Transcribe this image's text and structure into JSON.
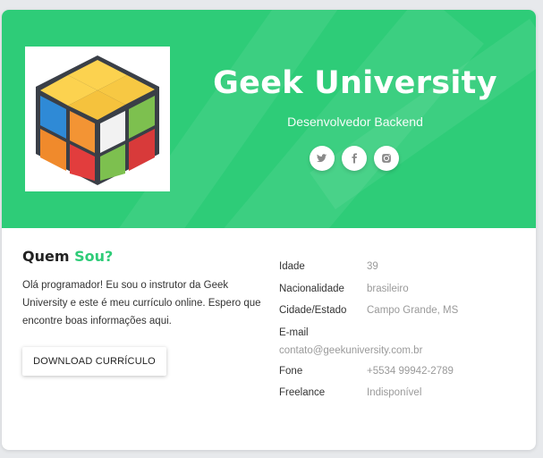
{
  "header": {
    "title": "Geek University",
    "subtitle": "Desenvolvedor Backend",
    "accent_color": "#2ecc78",
    "avatar_icon": "rubiks-cube-logo",
    "socials": [
      {
        "name": "twitter-icon"
      },
      {
        "name": "facebook-icon"
      },
      {
        "name": "instagram-icon"
      }
    ]
  },
  "about": {
    "title_prefix": "Quem",
    "title_accent": "Sou?",
    "text": "Olá programador! Eu sou o instrutor da Geek University e este é meu currículo online. Espero que encontre boas informações aqui.",
    "download_label": "DOWNLOAD CURRÍCULO"
  },
  "info": [
    {
      "label": "Idade",
      "value": "39"
    },
    {
      "label": "Nacionalidade",
      "value": "brasileiro"
    },
    {
      "label": "Cidade/Estado",
      "value": "Campo Grande, MS"
    },
    {
      "label": "E-mail",
      "value": "contato@geekuniversity.com.br"
    },
    {
      "label": "Fone",
      "value": "+5534 99942-2789"
    },
    {
      "label": "Freelance",
      "value": "Indisponível"
    }
  ]
}
